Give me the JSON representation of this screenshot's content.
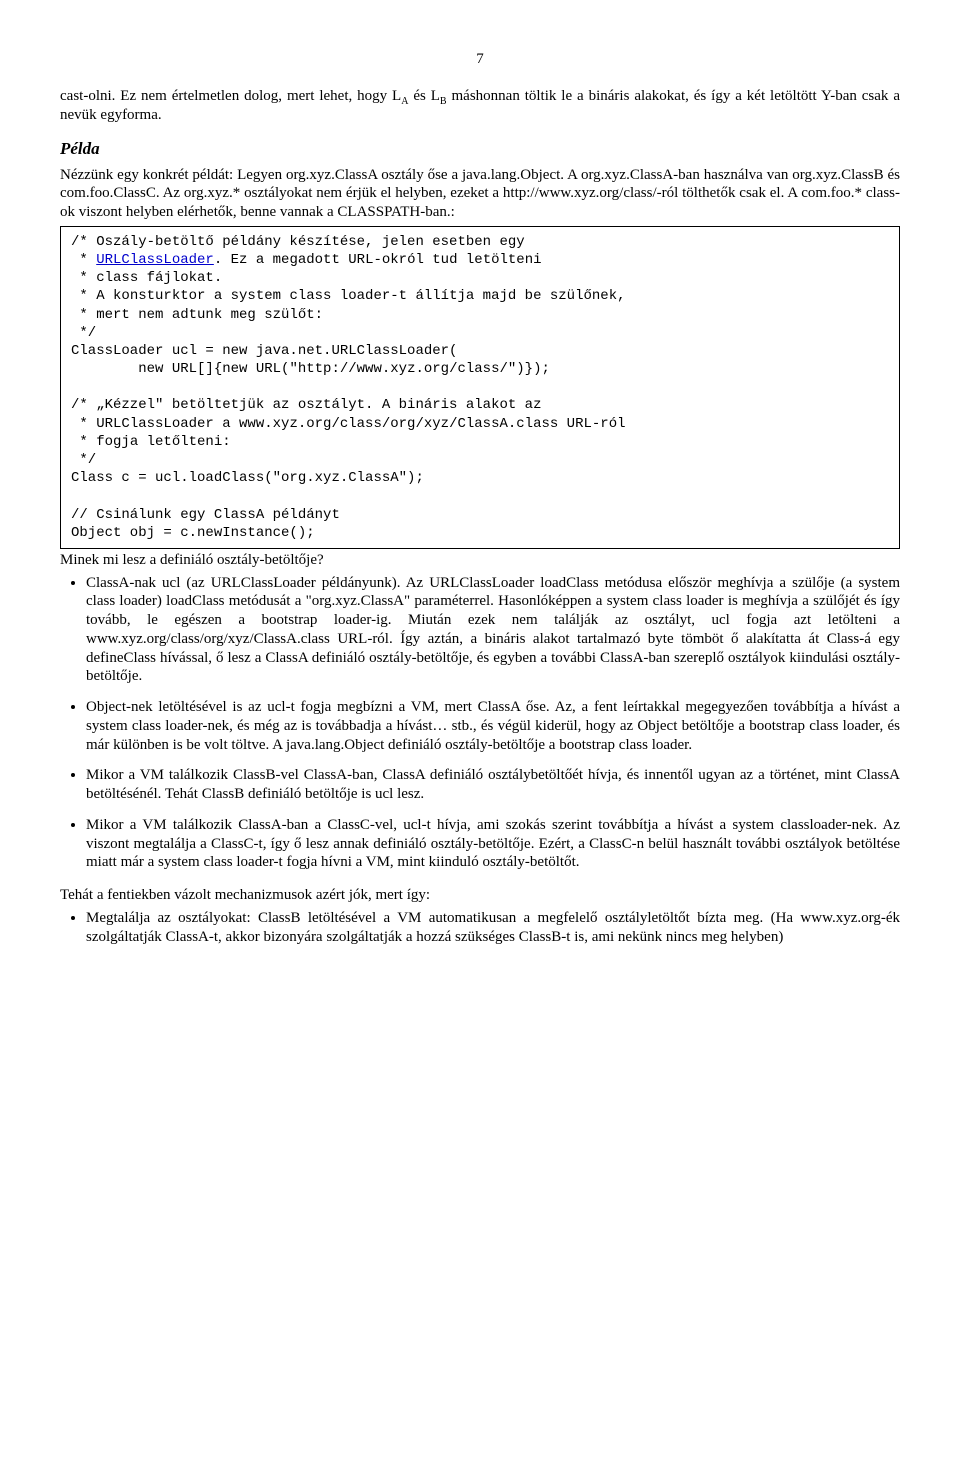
{
  "page_number": "7",
  "para1_a": "cast-olni. Ez nem értelmetlen dolog, mert lehet, hogy L",
  "para1_sub1": "A",
  "para1_b": " és L",
  "para1_sub2": "B",
  "para1_c": " máshonnan töltik le a bináris alakokat, és így a két letöltött Y-ban csak a nevük egyforma.",
  "heading_pelda": "Példa",
  "para2": "Nézzünk egy konkrét példát: Legyen org.xyz.ClassA osztály őse a java.lang.Object. A org.xyz.ClassA-ban használva van org.xyz.ClassB és com.foo.ClassC. Az org.xyz.* osztályokat nem érjük el helyben, ezeket a http://www.xyz.org/class/-ról tölthetők csak el. A com.foo.* class-ok viszont helyben elérhetők, benne vannak a CLASSPATH-ban.:",
  "code_prefix": "/* Oszály-betöltő példány készítése, jelen esetben egy\n * ",
  "code_link": "URLClassLoader",
  "code_rest": ". Ez a megadott URL-okról tud letölteni\n * class fájlokat.\n * A konsturktor a system class loader-t állítja majd be szülőnek,\n * mert nem adtunk meg szülőt:\n */\nClassLoader ucl = new java.net.URLClassLoader(\n        new URL[]{new URL(\"http://www.xyz.org/class/\")});\n\n/* „Kézzel\" betöltetjük az osztályt. A bináris alakot az\n * URLClassLoader a www.xyz.org/class/org/xyz/ClassA.class URL-ról\n * fogja letőlteni:\n */\nClass c = ucl.loadClass(\"org.xyz.ClassA\");\n\n// Csinálunk egy ClassA példányt\nObject obj = c.newInstance();",
  "para3": "Minek mi lesz a definiáló osztály-betöltője?",
  "bullets1": [
    "ClassA-nak ucl (az URLClassLoader példányunk). Az URLClassLoader loadClass metódusa először meghívja a szülője (a system class loader) loadClass metódusát a \"org.xyz.ClassA\" paraméterrel. Hasonlóképpen a system class loader is meghívja a szülőjét és így tovább, le egészen a bootstrap loader-ig. Miután ezek nem találják az osztályt, ucl fogja azt letölteni a www.xyz.org/class/org/xyz/ClassA.class URL-ról. Így aztán, a bináris alakot tartalmazó byte tömböt ő alakítatta át Class-á egy defineClass hívással, ő lesz a ClassA definiáló osztály-betöltője, és egyben a további ClassA-ban szereplő osztályok kiindulási osztály-betöltője.",
    "Object-nek letöltésével is az ucl-t fogja megbízni a VM, mert ClassA őse. Az, a fent leírtakkal megegyezően továbbítja a hívást a system class loader-nek, és még az is továbbadja a hívást… stb., és végül kiderül, hogy az Object betöltője a bootstrap class loader, és már különben is be volt töltve. A java.lang.Object definiáló osztály-betöltője a bootstrap class loader.",
    "Mikor a VM találkozik ClassB-vel ClassA-ban, ClassA definiáló osztálybetöltőét hívja, és innentől ugyan az a történet, mint ClassA betöltésénél. Tehát ClassB definiáló betöltője is ucl lesz.",
    "Mikor a VM találkozik ClassA-ban a ClassC-vel, ucl-t hívja, ami szokás szerint továbbítja a hívást a system classloader-nek. Az viszont megtalálja a ClassC-t, így ő lesz annak definiáló osztály-betöltője. Ezért, a ClassC-n belül használt további osztályok betöltése miatt már a system class loader-t fogja hívni a VM, mint kiinduló osztály-betöltőt."
  ],
  "para4": "Tehát a fentiekben vázolt mechanizmusok azért jók, mert így:",
  "bullets2": [
    "Megtalálja az osztályokat: ClassB letöltésével a VM automatikusan a megfelelő osztályletöltőt bízta meg. (Ha www.xyz.org-ék szolgáltatják ClassA-t, akkor bizonyára szolgáltatják a hozzá szükséges ClassB-t is, ami nekünk nincs meg helyben)"
  ]
}
